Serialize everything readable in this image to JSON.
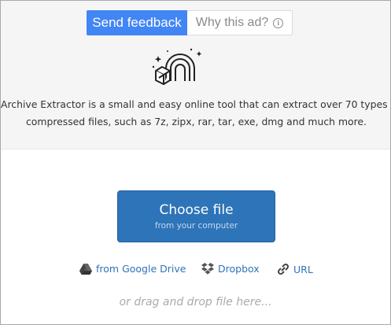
{
  "ad_bar": {
    "send_feedback_label": "Send feedback",
    "why_ad_label": "Why this ad?",
    "info_glyph": "i",
    "accent_color": "#4285f4"
  },
  "hero": {
    "logo_icon": "rainbow-box-icon",
    "description_line1": "Archive Extractor is a small and easy online tool that can extract over 70 types of",
    "description_line2": "compressed files, such as 7z, zipx, rar, tar, exe, dmg and much more."
  },
  "upload": {
    "choose_title": "Choose file",
    "choose_subtitle": "from your computer",
    "button_color": "#2e74b8",
    "sources": [
      {
        "label": "from Google Drive",
        "icon": "google-drive-icon"
      },
      {
        "label": "Dropbox",
        "icon": "dropbox-icon"
      },
      {
        "label": "URL",
        "icon": "link-icon"
      }
    ],
    "drag_hint": "or drag and drop file here..."
  }
}
